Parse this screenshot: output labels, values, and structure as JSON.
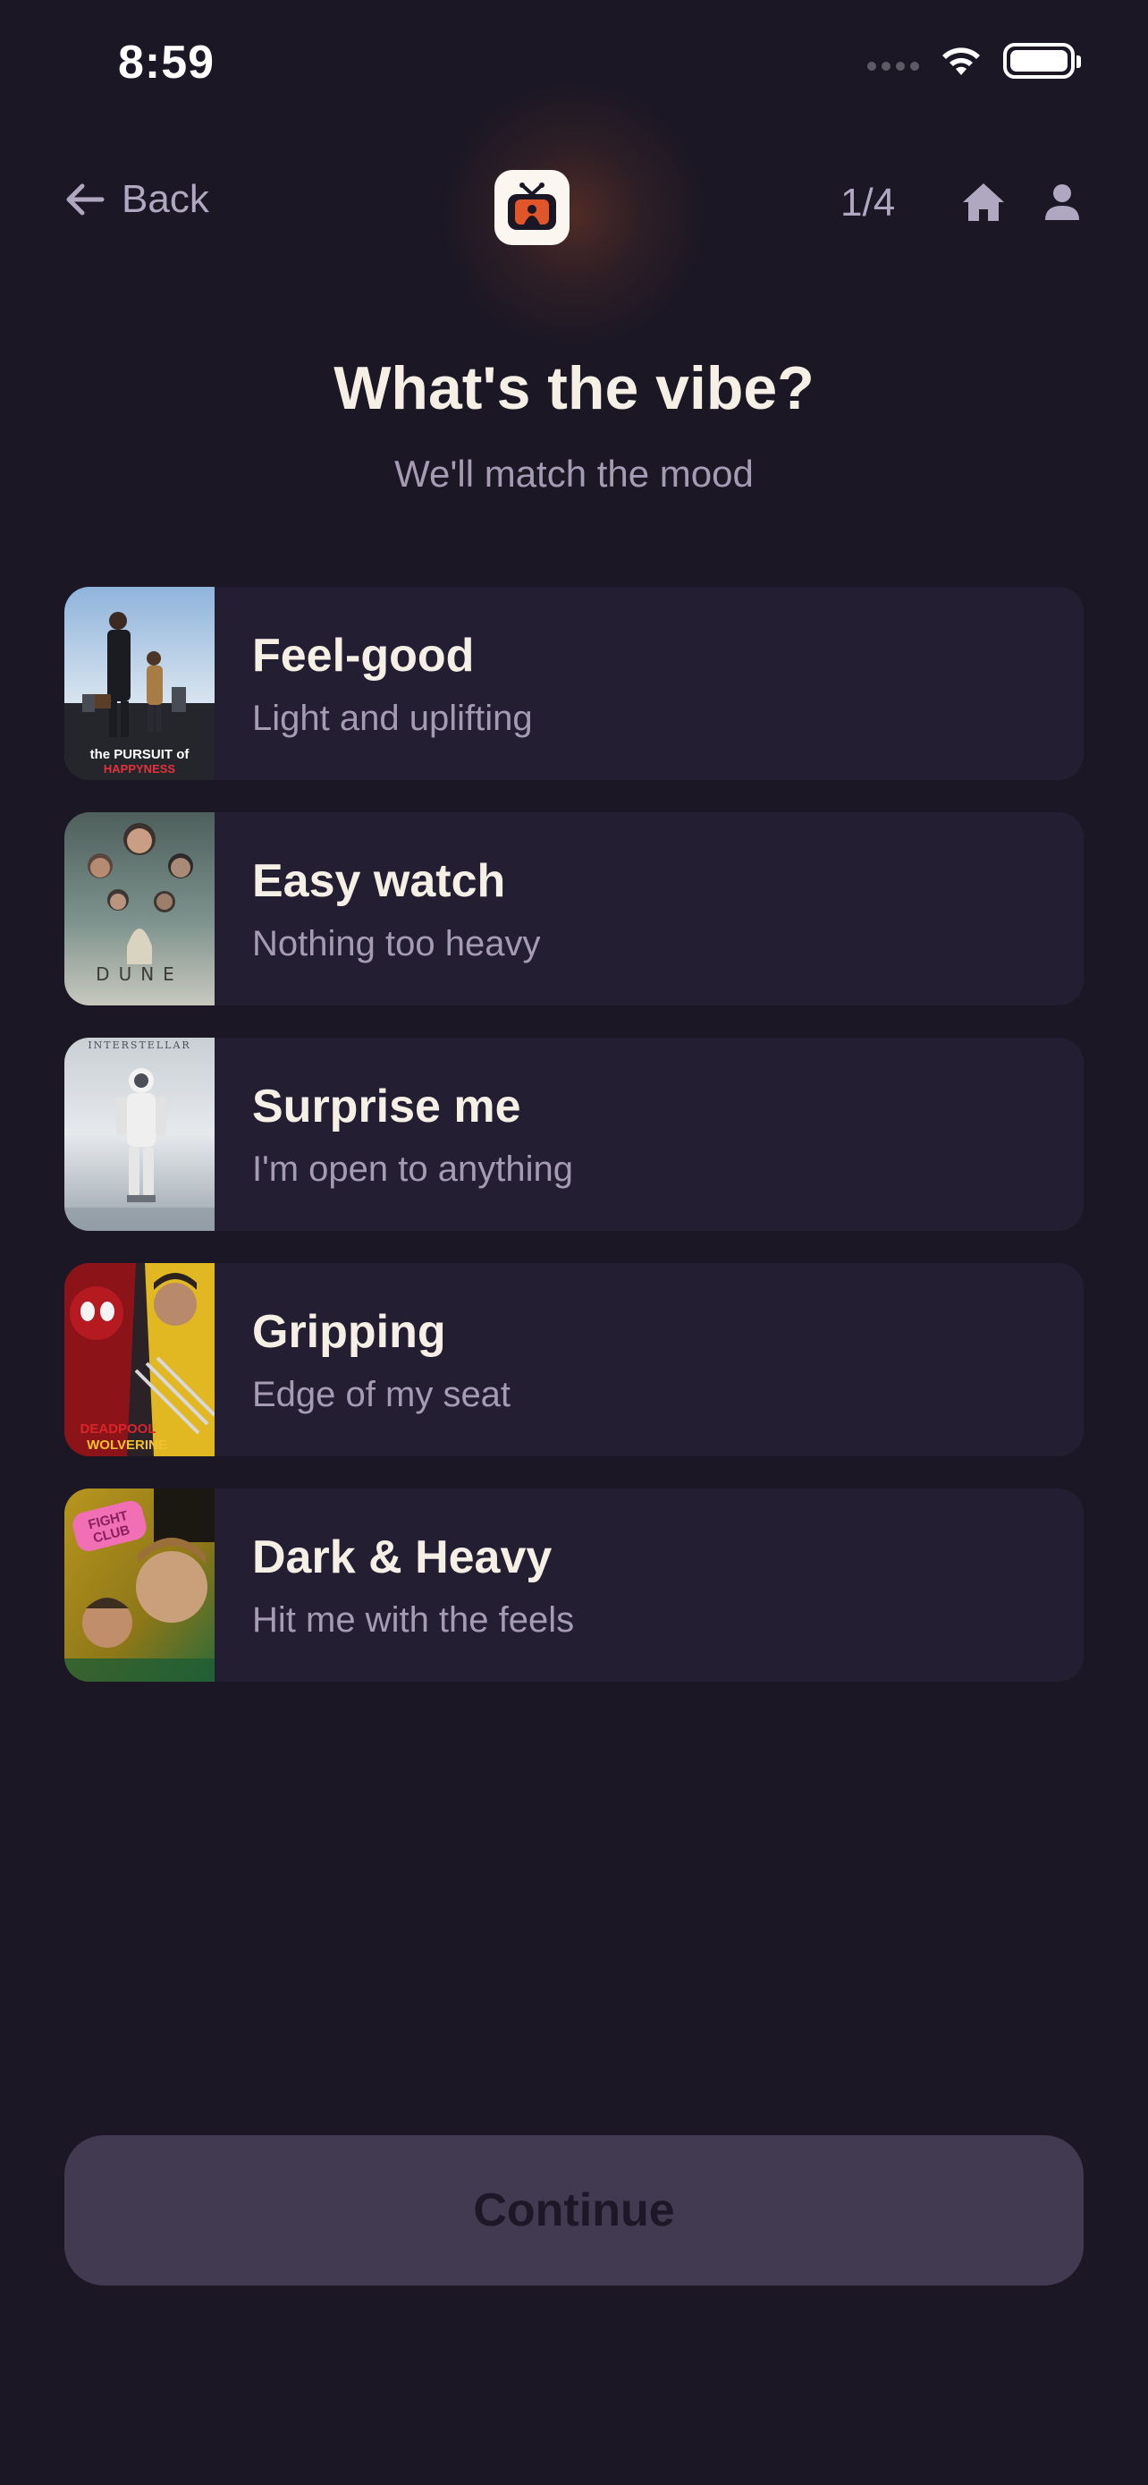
{
  "status_bar": {
    "time": "8:59"
  },
  "nav": {
    "back_label": "Back",
    "step": "1/4"
  },
  "header": {
    "title": "What's the vibe?",
    "subtitle": "We'll match the mood"
  },
  "options": [
    {
      "title": "Feel-good",
      "description": "Light and uplifting",
      "poster": "The Pursuit of Happyness",
      "poster_caption_line1": "the PURSUIT of",
      "poster_caption_line2": "HAPPYNESS"
    },
    {
      "title": "Easy watch",
      "description": "Nothing too heavy",
      "poster": "Dune",
      "poster_caption_line1": "DUNE"
    },
    {
      "title": "Surprise me",
      "description": "I'm open to anything",
      "poster": "Interstellar",
      "poster_caption_line1": "INTERSTELLAR"
    },
    {
      "title": "Gripping",
      "description": "Edge of my seat",
      "poster": "Deadpool & Wolverine",
      "poster_caption_line1": "DEADPOOL",
      "poster_caption_line2": "WOLVERINE"
    },
    {
      "title": "Dark & Heavy",
      "description": "Hit me with the feels",
      "poster": "Fight Club",
      "poster_caption_line1": "FIGHT",
      "poster_caption_line2": "CLUB"
    }
  ],
  "continue_label": "Continue",
  "colors": {
    "background": "#1b1725",
    "card": "#231e31",
    "accent": "#e0552a",
    "muted_text": "#a59cb4",
    "button_disabled": "#413a50"
  },
  "icons": {
    "back": "arrow-left-icon",
    "home": "home-icon",
    "profile": "person-icon",
    "logo": "tv-logo-icon"
  }
}
